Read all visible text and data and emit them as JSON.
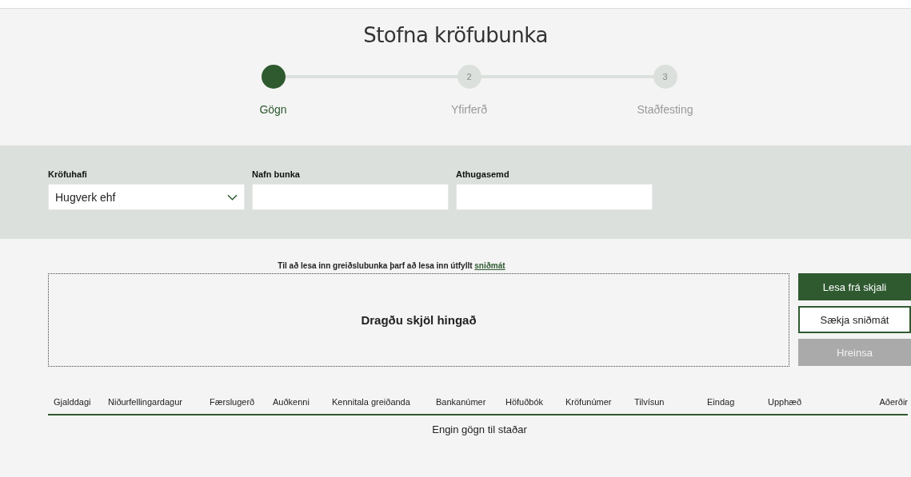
{
  "title": "Stofna kröfubunka",
  "steps": [
    {
      "label": "Gögn",
      "selected": true
    },
    {
      "number": "2",
      "label": "Yfirferð",
      "selected": false
    },
    {
      "number": "3",
      "label": "Staðfesting",
      "selected": false
    }
  ],
  "form": {
    "fields": [
      {
        "kind": "select",
        "label": "Kröfuhafi",
        "value": "Hugverk ehf"
      },
      {
        "kind": "text",
        "label": "Nafn bunka"
      },
      {
        "kind": "text",
        "label": "Athugasemd"
      }
    ]
  },
  "upload": {
    "hint": "Til að lesa inn greiðslubunka þarf að lesa inn útfyllt ",
    "hint_link": "sniðmát",
    "dropzone": "Dragðu skjöl hingað"
  },
  "buttons": [
    {
      "label": "Lesa frá skjali",
      "kind": "primary",
      "disabled": false
    },
    {
      "label": "Sækja sniðmát",
      "kind": "secondary",
      "disabled": false
    },
    {
      "label": "Hreinsa",
      "kind": "primary",
      "disabled": true
    }
  ],
  "table": {
    "columns": [
      "Gjalddagi",
      "Niðurfellingardagur",
      "Færslugerð",
      "Auðkenni",
      "Kennitala greiðanda",
      "Bankanúmer",
      "Höfuðbók",
      "Kröfunúmer",
      "Tilvísun",
      "Eindag",
      "Upphæð",
      "Aðerðir"
    ],
    "empty": "Engin gögn til staðar"
  }
}
